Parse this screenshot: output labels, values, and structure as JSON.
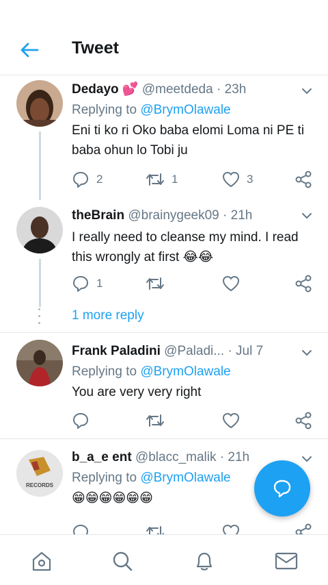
{
  "header": {
    "title": "Tweet"
  },
  "tweets": [
    {
      "name": "Dedayo",
      "name_emoji": "💕",
      "handle": "@meetdeda",
      "time": "23h",
      "reply_prefix": "Replying to",
      "reply_to": "@BrymOlawale",
      "text": "Eni ti ko ri Oko baba elomi Loma ni PE ti baba ohun lo Tobi ju",
      "reply_count": "2",
      "retweet_count": "1",
      "like_count": "3"
    },
    {
      "name": "theBrain",
      "handle": "@brainygeek09",
      "time": "21h",
      "text": "I really need to cleanse my mind. I read this wrongly at first",
      "emojis": [
        "😂",
        "😂"
      ],
      "reply_count": "1",
      "retweet_count": "",
      "like_count": ""
    },
    {
      "name": "Frank Paladini",
      "handle": "@Paladi...",
      "time": "Jul 7",
      "reply_prefix": "Replying to",
      "reply_to": "@BrymOlawale",
      "text": "You are very very right",
      "reply_count": "",
      "retweet_count": "",
      "like_count": ""
    },
    {
      "name": "b_a_e ent",
      "handle": "@blacc_malik",
      "time": "21h",
      "reply_prefix": "Replying to",
      "reply_to": "@BrymOlawale",
      "emojis": [
        "😁",
        "😁",
        "😁",
        "😁",
        "😁",
        "😁"
      ],
      "avatar_label": "RECORDS"
    }
  ],
  "more_reply": "1 more reply",
  "colors": {
    "accent": "#1da1f2",
    "secondary_text": "#657786",
    "like_pink": "#e0245e"
  },
  "icons": {
    "back": "arrow-left-icon",
    "caret": "chevron-down-icon",
    "reply": "reply-icon",
    "retweet": "retweet-icon",
    "like": "heart-icon",
    "share": "share-icon",
    "compose": "compose-reply-icon",
    "home": "home-icon",
    "search": "search-icon",
    "notifications": "bell-icon",
    "messages": "envelope-icon"
  }
}
